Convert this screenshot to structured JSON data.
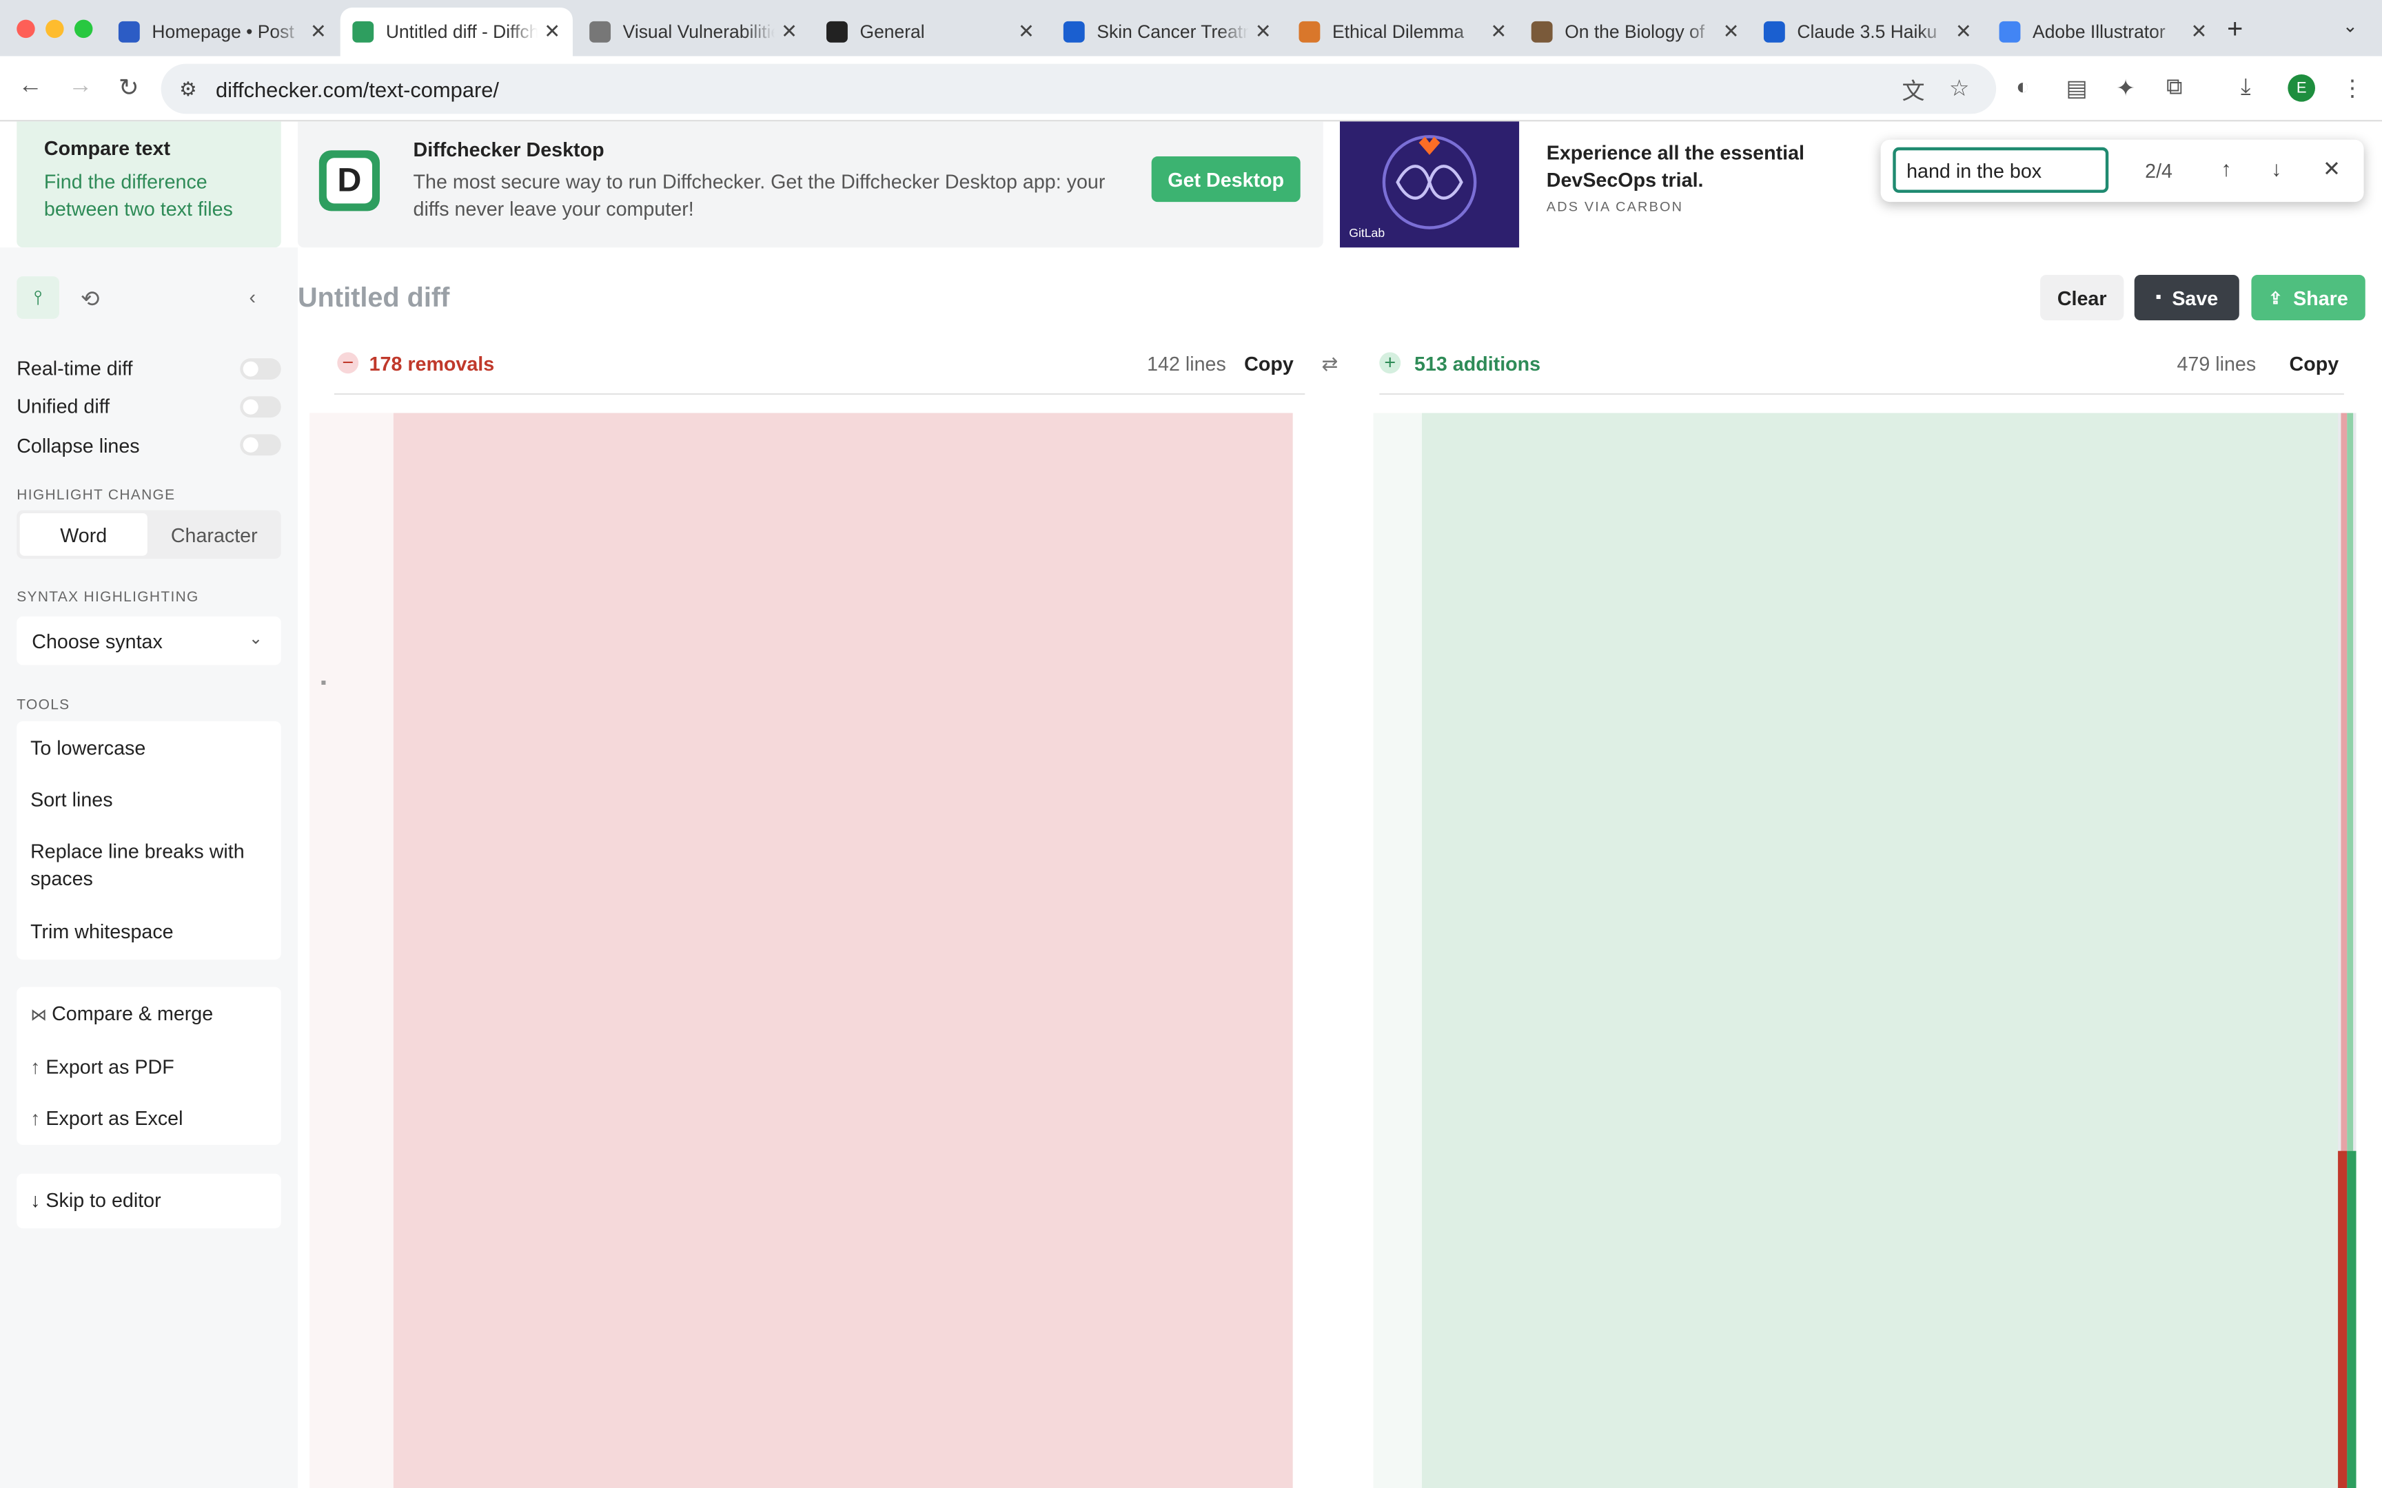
{
  "browser": {
    "tabs": [
      {
        "title": "Homepage • Post",
        "icon_color": "#2c5cc5"
      },
      {
        "title": "Untitled diff - Diffchecker",
        "icon_color": "#2e9e5f"
      },
      {
        "title": "Visual Vulnerabilities",
        "icon_color": "#777777"
      },
      {
        "title": "General",
        "icon_color": "#222222"
      },
      {
        "title": "Skin Cancer Treatment",
        "icon_color": "#1a5fd0"
      },
      {
        "title": "Ethical Dilemma",
        "icon_color": "#d9772b"
      },
      {
        "title": "On the Biology of",
        "icon_color": "#7a5a3a"
      },
      {
        "title": "Claude 3.5 Haiku",
        "icon_color": "#1a5fd0"
      },
      {
        "title": "Adobe Illustrator",
        "icon_color": "#4285f4"
      }
    ],
    "url": "diffchecker.com/text-compare/",
    "profile_initial": "E"
  },
  "promo": {
    "compare_title": "Compare text",
    "compare_sub": "Find the difference between two text files",
    "desktop_title": "Diffchecker Desktop",
    "desktop_sub": "The most secure way to run Diffchecker. Get the Diffchecker Desktop app: your diffs never leave your computer!",
    "desktop_btn": "Get Desktop",
    "ad_brand": "GitLab",
    "ad_text": "Experience all the essential DevSecOps trial.",
    "ad_via": "ADS VIA CARBON"
  },
  "find": {
    "query": "hand in the box",
    "count": "2/4"
  },
  "sidebar": {
    "options": [
      "Real-time diff",
      "Unified diff",
      "Collapse lines"
    ],
    "highlight_label": "HIGHLIGHT CHANGE",
    "highlight_word": "Word",
    "highlight_char": "Character",
    "syntax_label": "SYNTAX HIGHLIGHTING",
    "syntax_value": "Choose syntax",
    "tools_label": "TOOLS",
    "tools": [
      "To lowercase",
      "Sort lines",
      "Replace line breaks with spaces",
      "Trim whitespace"
    ],
    "actions": [
      "Compare & merge",
      "Export as PDF",
      "Export as Excel"
    ],
    "skip": "Skip to editor"
  },
  "diff": {
    "title": "Untitled diff",
    "clear": "Clear",
    "save": "Save",
    "share": "Share",
    "left": {
      "summary": "178 removals",
      "lines": "142 lines",
      "copy": "Copy"
    },
    "right": {
      "summary": "513 additions",
      "lines": "479 lines",
      "copy": "Copy"
    }
  }
}
